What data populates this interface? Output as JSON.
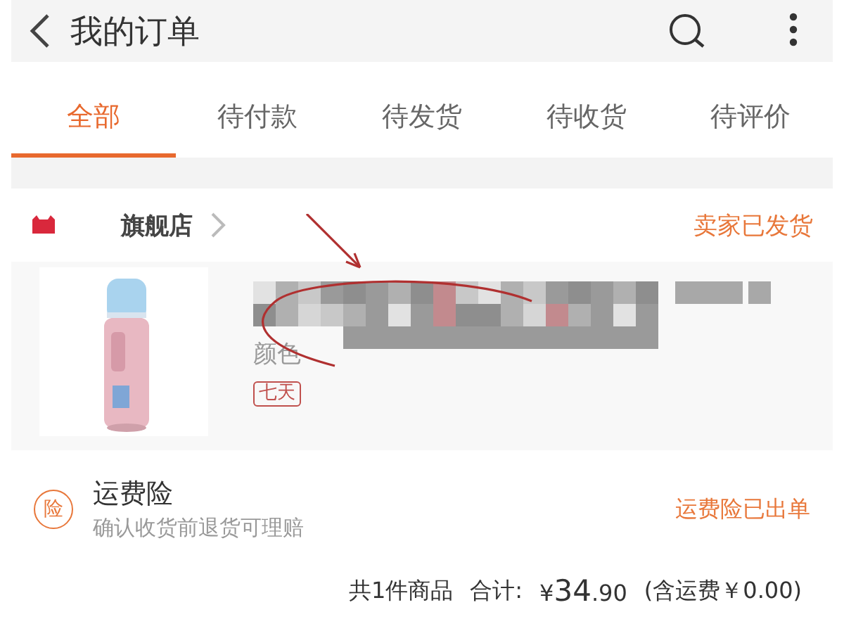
{
  "header": {
    "title": "我的订单"
  },
  "tabs": [
    {
      "label": "全部",
      "selected": true
    },
    {
      "label": "待付款",
      "selected": false
    },
    {
      "label": "待发货",
      "selected": false
    },
    {
      "label": "待收货",
      "selected": false
    },
    {
      "label": "待评价",
      "selected": false
    }
  ],
  "order": {
    "shop": "旗舰店",
    "status": "卖家已发货",
    "product": {
      "option_label": "颜色",
      "tag": "七天"
    },
    "insurance": {
      "badge": "险",
      "title": "运费险",
      "note": "确认收货前退货可理赔",
      "status": "运费险已出单"
    },
    "summary": {
      "count": "共1件商品",
      "total_label": "合计:",
      "currency": "¥",
      "integer": "34",
      "decimal": ".90",
      "shipping": "(含运费￥0.00)"
    }
  }
}
